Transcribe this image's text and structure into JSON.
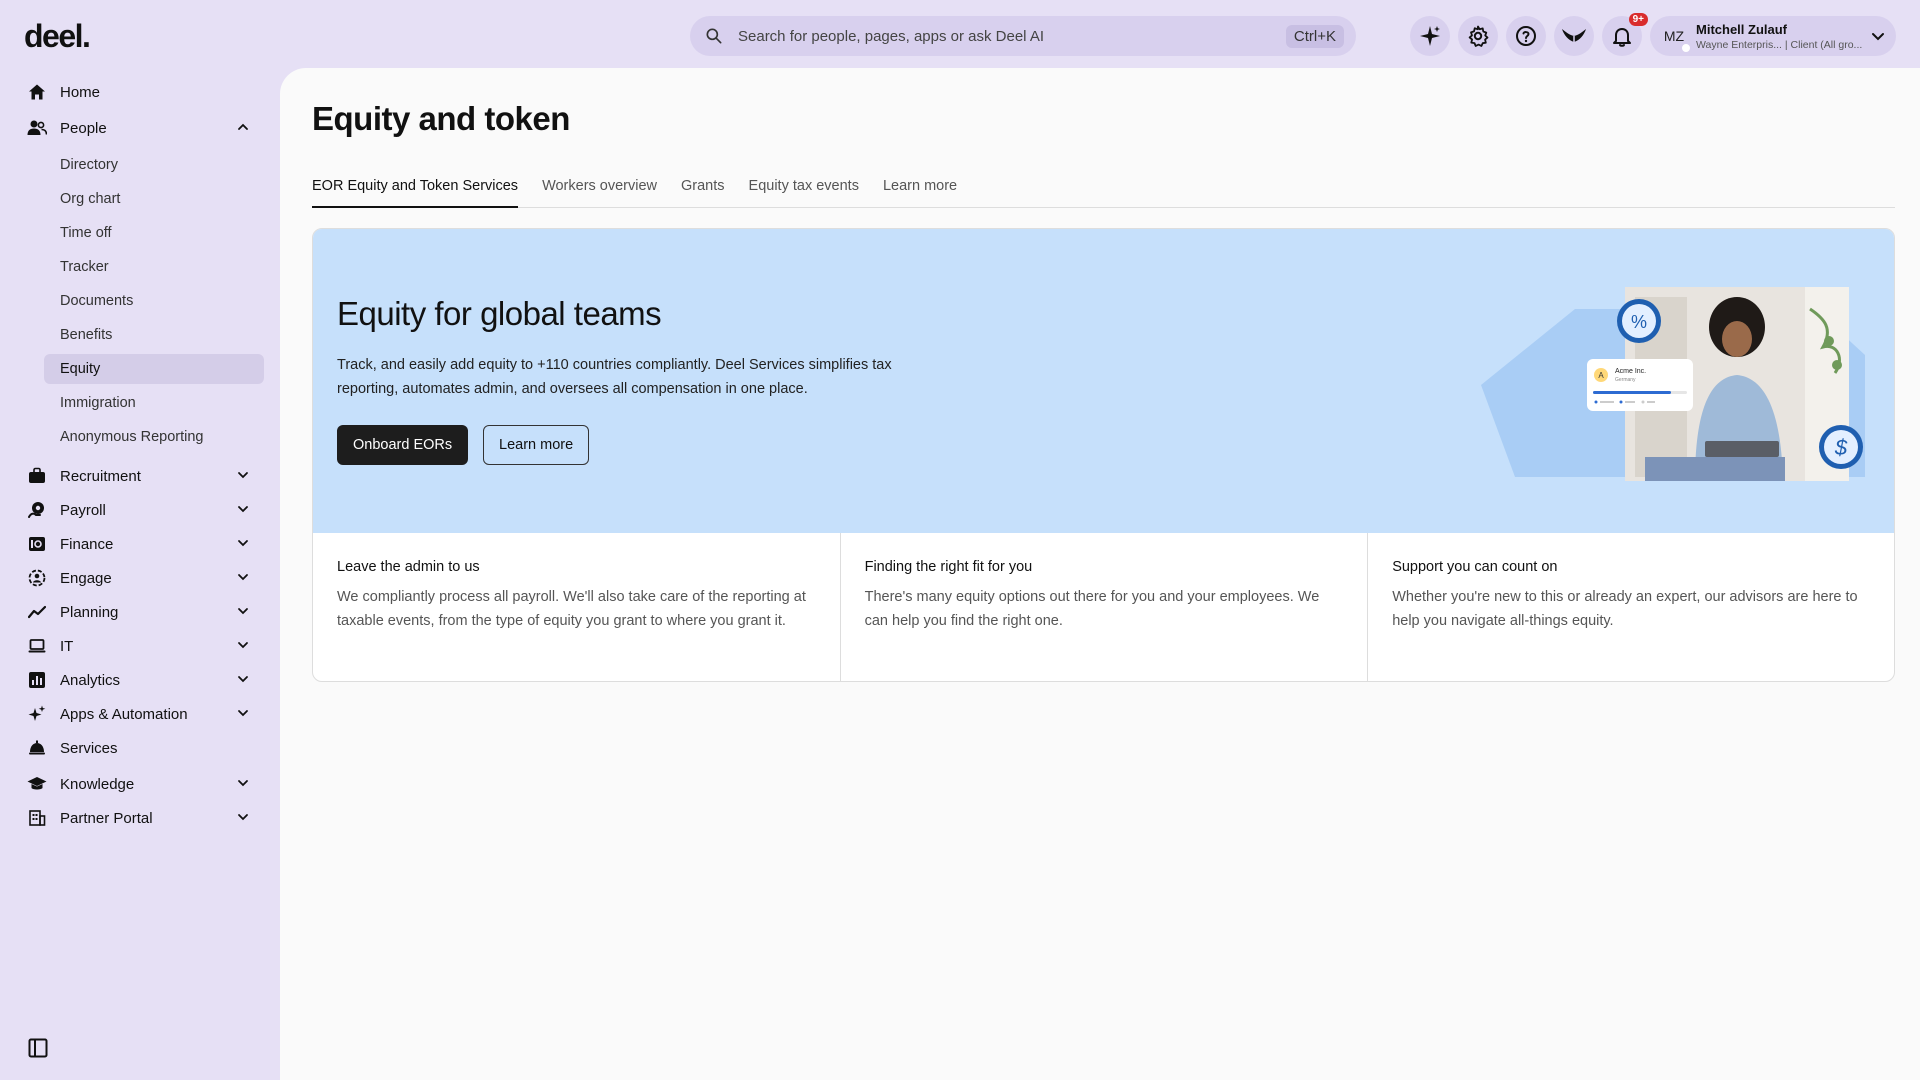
{
  "brand": {
    "logo": "deel."
  },
  "search": {
    "placeholder": "Search for people, pages, apps or ask Deel AI",
    "shortcut": "Ctrl+K"
  },
  "topbar": {
    "icons": [
      "sparkle-icon",
      "gear-icon",
      "help-icon",
      "deel-bird-icon",
      "bell-icon"
    ],
    "notifications_badge": "9+"
  },
  "user": {
    "initials": "MZ",
    "name": "Mitchell Zulauf",
    "subtitle": "Wayne Enterpris... | Client (All gro..."
  },
  "sidebar": {
    "items": [
      {
        "label": "Home",
        "icon": "home-icon"
      },
      {
        "label": "People",
        "icon": "people-icon",
        "expanded": true
      },
      {
        "label": "Recruitment",
        "icon": "briefcase-icon"
      },
      {
        "label": "Payroll",
        "icon": "payroll-icon"
      },
      {
        "label": "Finance",
        "icon": "finance-icon"
      },
      {
        "label": "Engage",
        "icon": "engage-icon"
      },
      {
        "label": "Planning",
        "icon": "planning-icon"
      },
      {
        "label": "IT",
        "icon": "laptop-icon"
      },
      {
        "label": "Analytics",
        "icon": "analytics-icon"
      },
      {
        "label": "Apps & Automation",
        "icon": "automation-icon"
      },
      {
        "label": "Services",
        "icon": "services-icon"
      },
      {
        "label": "Knowledge",
        "icon": "graduation-cap-icon"
      },
      {
        "label": "Partner Portal",
        "icon": "building-icon"
      }
    ],
    "people_sub": [
      {
        "label": "Directory"
      },
      {
        "label": "Org chart"
      },
      {
        "label": "Time off"
      },
      {
        "label": "Tracker"
      },
      {
        "label": "Documents"
      },
      {
        "label": "Benefits"
      },
      {
        "label": "Equity",
        "active": true
      },
      {
        "label": "Immigration"
      },
      {
        "label": "Anonymous Reporting"
      }
    ]
  },
  "page": {
    "title": "Equity and token",
    "tabs": [
      {
        "label": "EOR Equity and Token Services",
        "active": true
      },
      {
        "label": "Workers overview"
      },
      {
        "label": "Grants"
      },
      {
        "label": "Equity tax events"
      },
      {
        "label": "Learn more"
      }
    ]
  },
  "hero": {
    "heading": "Equity for global teams",
    "body": "Track, and easily add equity to +110 countries compliantly. Deel Services simplifies tax reporting, automates admin, and oversees all compensation in one place.",
    "primary_button": "Onboard EORs",
    "secondary_button": "Learn more",
    "illustration_card_title": "Acme Inc.",
    "illustration_card_sub": "Germany",
    "illustration_card_letter": "A",
    "colors": {
      "background": "#c6e0fb",
      "shape": "#a9cdf5"
    }
  },
  "features": [
    {
      "title": "Leave the admin to us",
      "body": "We compliantly process all payroll. We'll also take care of the reporting at taxable events, from the type of equity you grant to where you grant it."
    },
    {
      "title": "Finding the right fit for you",
      "body": "There's many equity options out there for you and your employees. We can help you find the right one."
    },
    {
      "title": "Support you can count on",
      "body": "Whether you're new to this or already an expert, our advisors are here to help you navigate all-things equity."
    }
  ]
}
